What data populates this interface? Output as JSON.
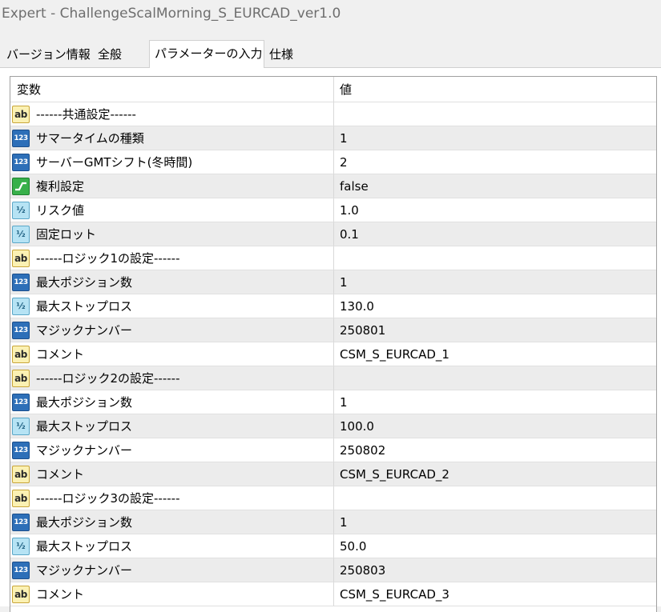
{
  "window": {
    "title": "Expert - ChallengeScalMorning_S_EURCAD_ver1.0"
  },
  "tabs": [
    {
      "label": "バージョン情報",
      "active": false
    },
    {
      "label": "全般",
      "active": false
    },
    {
      "label": "パラメーターの入力",
      "active": true
    },
    {
      "label": "仕様",
      "active": false
    }
  ],
  "table": {
    "columns": {
      "variable": "変数",
      "value": "値"
    },
    "rows": [
      {
        "icon": "string-icon",
        "name": "------共通設定------",
        "value": ""
      },
      {
        "icon": "integer-icon",
        "name": "サマータイムの種類",
        "value": "1"
      },
      {
        "icon": "integer-icon",
        "name": "サーバーGMTシフト(冬時間)",
        "value": "2"
      },
      {
        "icon": "boolean-icon",
        "name": "複利設定",
        "value": "false"
      },
      {
        "icon": "double-icon",
        "name": "リスク値",
        "value": "1.0"
      },
      {
        "icon": "double-icon",
        "name": "固定ロット",
        "value": "0.1"
      },
      {
        "icon": "string-icon",
        "name": "------ロジック1の設定------",
        "value": ""
      },
      {
        "icon": "integer-icon",
        "name": "最大ポジション数",
        "value": "1"
      },
      {
        "icon": "double-icon",
        "name": "最大ストップロス",
        "value": "130.0"
      },
      {
        "icon": "integer-icon",
        "name": "マジックナンバー",
        "value": "250801"
      },
      {
        "icon": "string-icon",
        "name": "コメント",
        "value": "CSM_S_EURCAD_1"
      },
      {
        "icon": "string-icon",
        "name": "------ロジック2の設定------",
        "value": ""
      },
      {
        "icon": "integer-icon",
        "name": "最大ポジション数",
        "value": "1"
      },
      {
        "icon": "double-icon",
        "name": "最大ストップロス",
        "value": "100.0"
      },
      {
        "icon": "integer-icon",
        "name": "マジックナンバー",
        "value": "250802"
      },
      {
        "icon": "string-icon",
        "name": "コメント",
        "value": "CSM_S_EURCAD_2"
      },
      {
        "icon": "string-icon",
        "name": "------ロジック3の設定------",
        "value": ""
      },
      {
        "icon": "integer-icon",
        "name": "最大ポジション数",
        "value": "1"
      },
      {
        "icon": "double-icon",
        "name": "最大ストップロス",
        "value": "50.0"
      },
      {
        "icon": "integer-icon",
        "name": "マジックナンバー",
        "value": "250803"
      },
      {
        "icon": "string-icon",
        "name": "コメント",
        "value": "CSM_S_EURCAD_3"
      }
    ]
  },
  "icon_glyphs": {
    "string": "ab",
    "integer": "123",
    "double": "½"
  }
}
